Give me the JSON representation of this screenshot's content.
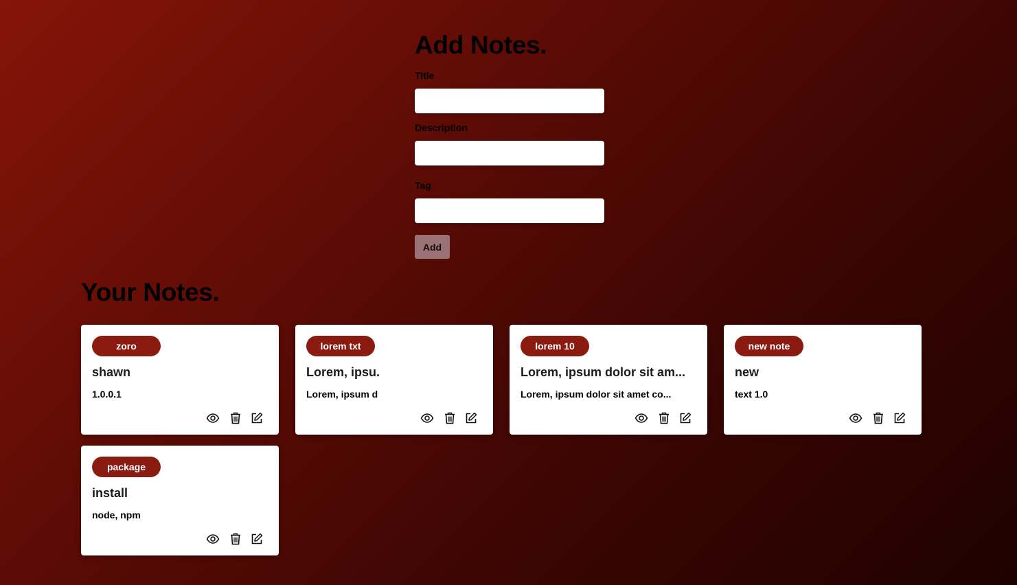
{
  "add_form": {
    "heading": "Add Notes.",
    "title_label": "Title",
    "title_value": "",
    "description_label": "Description",
    "description_value": "",
    "tag_label": "Tag",
    "tag_value": "",
    "add_button_label": "Add"
  },
  "notes_section": {
    "heading": "Your Notes.",
    "notes": [
      {
        "tag": "zoro",
        "title": "shawn",
        "description": "1.0.0.1"
      },
      {
        "tag": "lorem txt",
        "title": "Lorem, ipsu.",
        "description": "Lorem, ipsum d"
      },
      {
        "tag": "lorem 10",
        "title": "Lorem, ipsum dolor sit am...",
        "description": "Lorem, ipsum dolor sit amet co..."
      },
      {
        "tag": "new note",
        "title": "new",
        "description": "text 1.0"
      },
      {
        "tag": "package",
        "title": "install",
        "description": "node, npm"
      }
    ],
    "icons": {
      "view": "eye-icon",
      "delete": "trash-icon",
      "edit": "edit-icon"
    }
  },
  "colors": {
    "tag_badge": "#8b1a10",
    "add_button": "#9a7275",
    "card": "#ffffff"
  }
}
